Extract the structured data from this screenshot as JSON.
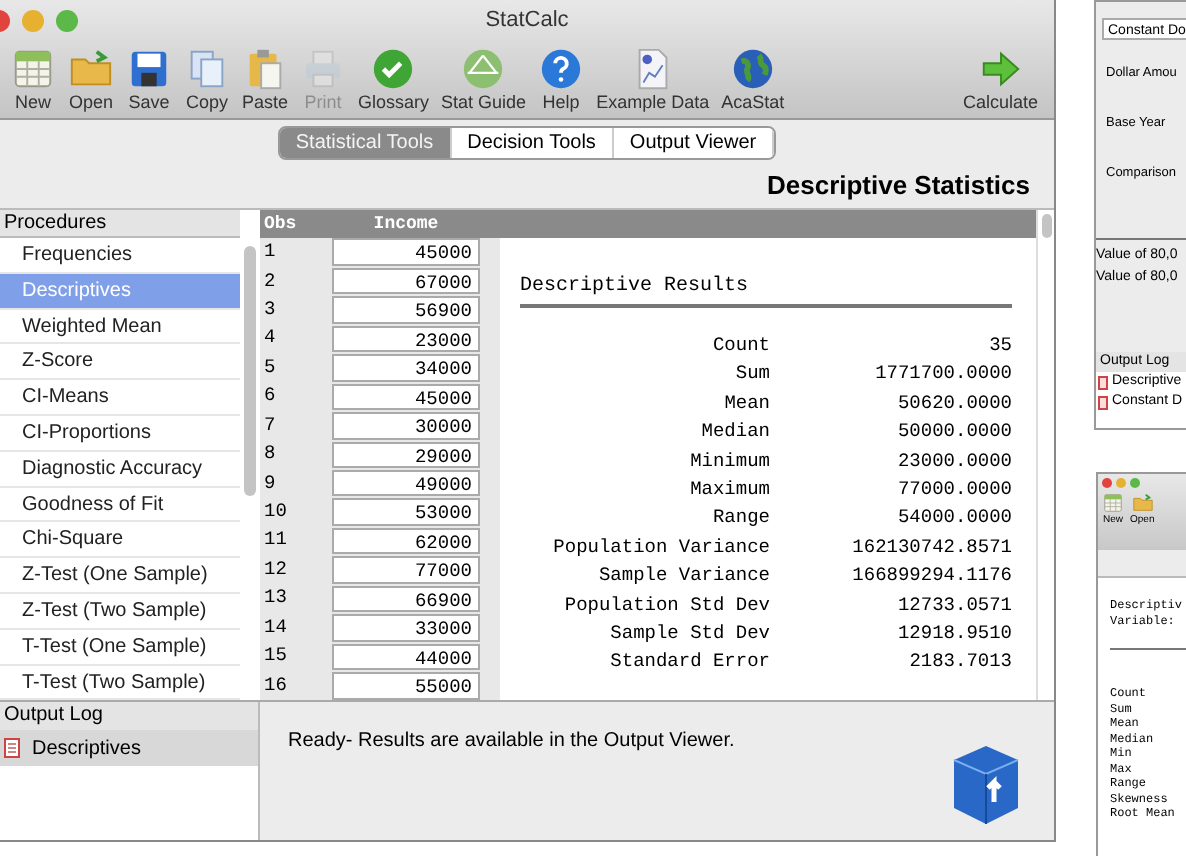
{
  "window": {
    "title": "StatCalc"
  },
  "toolbar": [
    {
      "label": "New",
      "disabled": false
    },
    {
      "label": "Open",
      "disabled": false
    },
    {
      "label": "Save",
      "disabled": false
    },
    {
      "label": "Copy",
      "disabled": false
    },
    {
      "label": "Paste",
      "disabled": false
    },
    {
      "label": "Print",
      "disabled": true
    },
    {
      "label": "Glossary",
      "disabled": false
    },
    {
      "label": "Stat Guide",
      "disabled": false
    },
    {
      "label": "Help",
      "disabled": false
    },
    {
      "label": "Example Data",
      "disabled": false
    },
    {
      "label": "AcaStat",
      "disabled": false
    }
  ],
  "calculate": {
    "label": "Calculate"
  },
  "tabs": [
    {
      "label": "Statistical Tools",
      "selected": true
    },
    {
      "label": "Decision Tools",
      "selected": false
    },
    {
      "label": "Output Viewer",
      "selected": false
    }
  ],
  "header": "Descriptive Statistics",
  "procedures": {
    "title": "Procedures",
    "items": [
      {
        "label": "Frequencies",
        "selected": false
      },
      {
        "label": "Descriptives",
        "selected": true
      },
      {
        "label": "Weighted Mean",
        "selected": false
      },
      {
        "label": "Z-Score",
        "selected": false
      },
      {
        "label": "CI-Means",
        "selected": false
      },
      {
        "label": "CI-Proportions",
        "selected": false
      },
      {
        "label": "Diagnostic Accuracy",
        "selected": false
      },
      {
        "label": "Goodness of Fit",
        "selected": false
      },
      {
        "label": "Chi-Square",
        "selected": false
      },
      {
        "label": "Z-Test (One Sample)",
        "selected": false
      },
      {
        "label": "Z-Test (Two Sample)",
        "selected": false
      },
      {
        "label": "T-Test (One Sample)",
        "selected": false
      },
      {
        "label": "T-Test (Two Sample)",
        "selected": false
      }
    ]
  },
  "data_table": {
    "columns": [
      "Obs",
      "Income"
    ],
    "rows": [
      [
        "1",
        "45000"
      ],
      [
        "2",
        "67000"
      ],
      [
        "3",
        "56900"
      ],
      [
        "4",
        "23000"
      ],
      [
        "5",
        "34000"
      ],
      [
        "6",
        "45000"
      ],
      [
        "7",
        "30000"
      ],
      [
        "8",
        "29000"
      ],
      [
        "9",
        "49000"
      ],
      [
        "10",
        "53000"
      ],
      [
        "11",
        "62000"
      ],
      [
        "12",
        "77000"
      ],
      [
        "13",
        "66900"
      ],
      [
        "14",
        "33000"
      ],
      [
        "15",
        "44000"
      ],
      [
        "16",
        "55000"
      ]
    ]
  },
  "results": {
    "title": "Descriptive Results",
    "rows": [
      {
        "label": "Count",
        "value": "35"
      },
      {
        "label": "Sum",
        "value": "1771700.0000"
      },
      {
        "label": "Mean",
        "value": "50620.0000"
      },
      {
        "label": "Median",
        "value": "50000.0000"
      },
      {
        "label": "Minimum",
        "value": "23000.0000"
      },
      {
        "label": "Maximum",
        "value": "77000.0000"
      },
      {
        "label": "Range",
        "value": "54000.0000"
      },
      {
        "label": "Population Variance",
        "value": "162130742.8571"
      },
      {
        "label": "Sample Variance",
        "value": "166899294.1176"
      },
      {
        "label": "Population Std Dev",
        "value": "12733.0571"
      },
      {
        "label": "Sample Std Dev",
        "value": "12918.9510"
      },
      {
        "label": "Standard Error",
        "value": "2183.7013"
      }
    ]
  },
  "output_log": {
    "title": "Output Log",
    "items": [
      {
        "label": "Descriptives",
        "selected": true
      }
    ]
  },
  "status": "Ready- Results are available in the Output Viewer.",
  "back_window_top": {
    "dropdown": "Constant Do",
    "fields": [
      "Dollar Amou",
      "Base Year",
      "Comparison"
    ],
    "results": [
      "Value of 80,0",
      "Value of 80,0"
    ],
    "log_title": "Output Log",
    "log_items": [
      "Descriptive",
      "Constant D"
    ]
  },
  "back_window_bottom": {
    "toolbar": [
      "New",
      "Open"
    ],
    "heading": [
      "Descriptiv",
      "Variable:"
    ],
    "stats": [
      "Count",
      "Sum",
      "Mean",
      "Median",
      "Min",
      "Max",
      "Range",
      "Skewness",
      "Root Mean"
    ]
  }
}
